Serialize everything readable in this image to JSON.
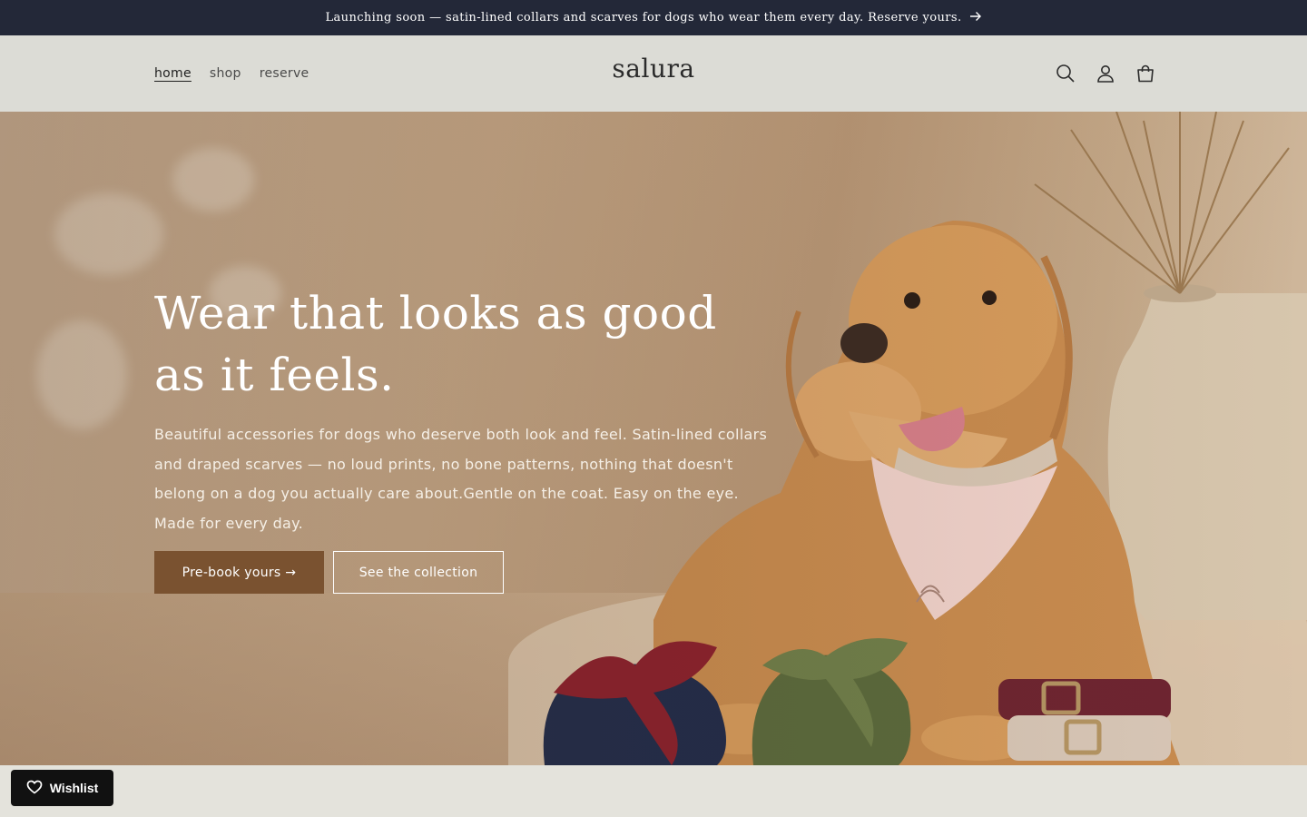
{
  "announcement": {
    "text": "Launching soon — satin-lined collars and scarves for dogs who wear them every day. Reserve yours.",
    "arrow_icon": "arrow-right-icon"
  },
  "header": {
    "logo": "salura",
    "nav": [
      {
        "label": "home",
        "active": true
      },
      {
        "label": "shop",
        "active": false
      },
      {
        "label": "reserve",
        "active": false
      }
    ],
    "icons": [
      "search-icon",
      "account-icon",
      "cart-icon"
    ]
  },
  "hero": {
    "title": "Wear that looks as good as it feels.",
    "description": "Beautiful accessories for dogs who deserve both look and feel. Satin-lined collars and draped scarves — no loud prints, no bone patterns, nothing that doesn't belong on a dog you actually care about.Gentle on the coat. Easy on the eye. Made for every day.",
    "primary_button": "Pre-book yours →",
    "secondary_button": "See the collection",
    "image_subject": "golden retriever wearing a pink satin scarf and collar with satin scarves and collars in front",
    "colors": {
      "primary_button": "#7a5230",
      "title": "#ffffff"
    }
  },
  "wishlist": {
    "label": "Wishlist",
    "icon": "heart-icon"
  },
  "colors": {
    "announcement_bg": "#232838",
    "header_bg": "#dcdcd6",
    "page_bg": "#e4e3dc"
  }
}
